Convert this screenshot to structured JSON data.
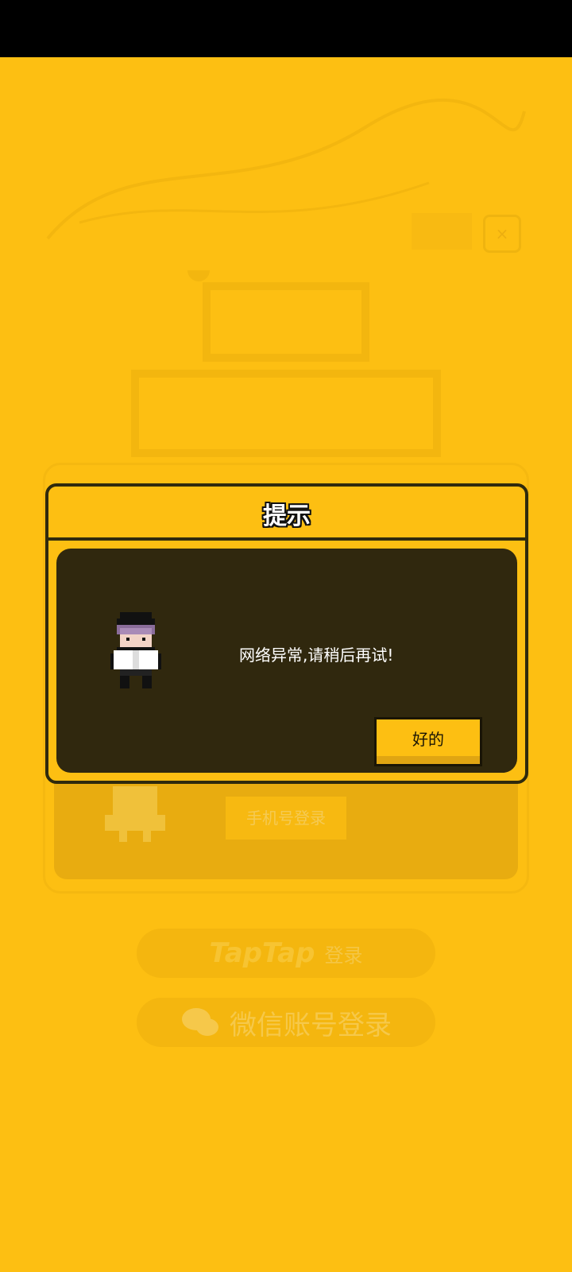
{
  "dialog": {
    "title": "提示",
    "message": "网络异常,请稍后再试!",
    "ok_label": "好的"
  },
  "background": {
    "close_glyph": "×",
    "phone_login_label": "手机号登录",
    "taptap_logo": "TapTap",
    "taptap_suffix": "登录",
    "wechat_login_label": "微信账号登录"
  },
  "colors": {
    "background": "#fdbf12",
    "dialog_body": "#30280e",
    "border": "#2f2a0d"
  },
  "icons": {
    "close": "close-icon",
    "wechat": "wechat-icon",
    "character": "pixel-character-icon"
  }
}
